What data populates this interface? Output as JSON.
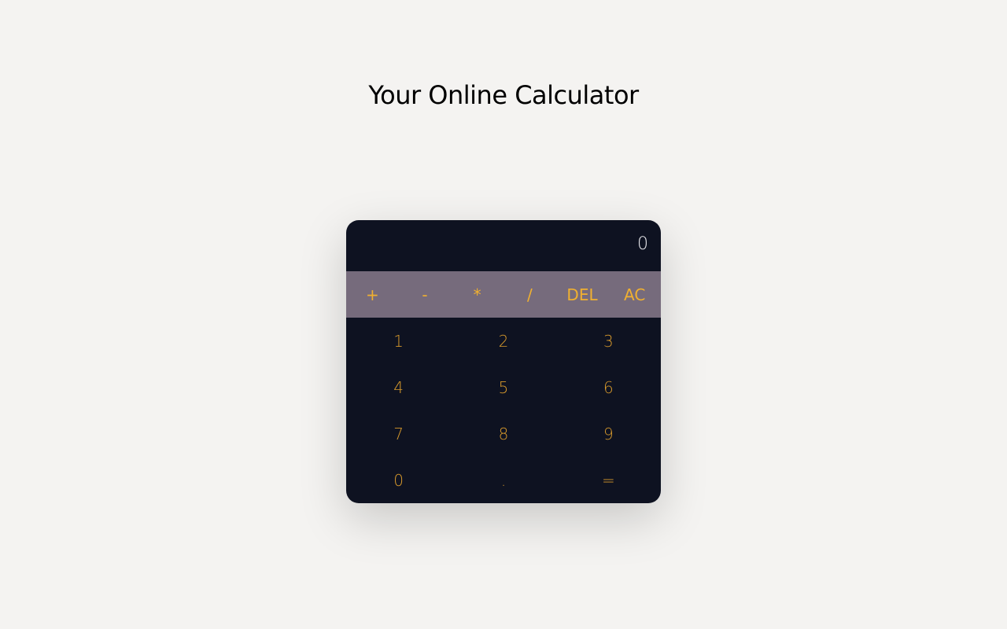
{
  "page": {
    "title": "Your Online Calculator"
  },
  "calculator": {
    "display_value": "0",
    "operators": [
      "+",
      "-",
      "*",
      "/",
      "DEL",
      "AC"
    ],
    "digits": [
      "1",
      "2",
      "3",
      "4",
      "5",
      "6",
      "7",
      "8",
      "9",
      "0",
      ".",
      "="
    ]
  },
  "colors": {
    "background": "#f4f3f1",
    "calculator_body": "#0e1221",
    "operator_bar": "#766b7c",
    "button_text": "#f0b030",
    "display_text": "#e8e8ec"
  }
}
